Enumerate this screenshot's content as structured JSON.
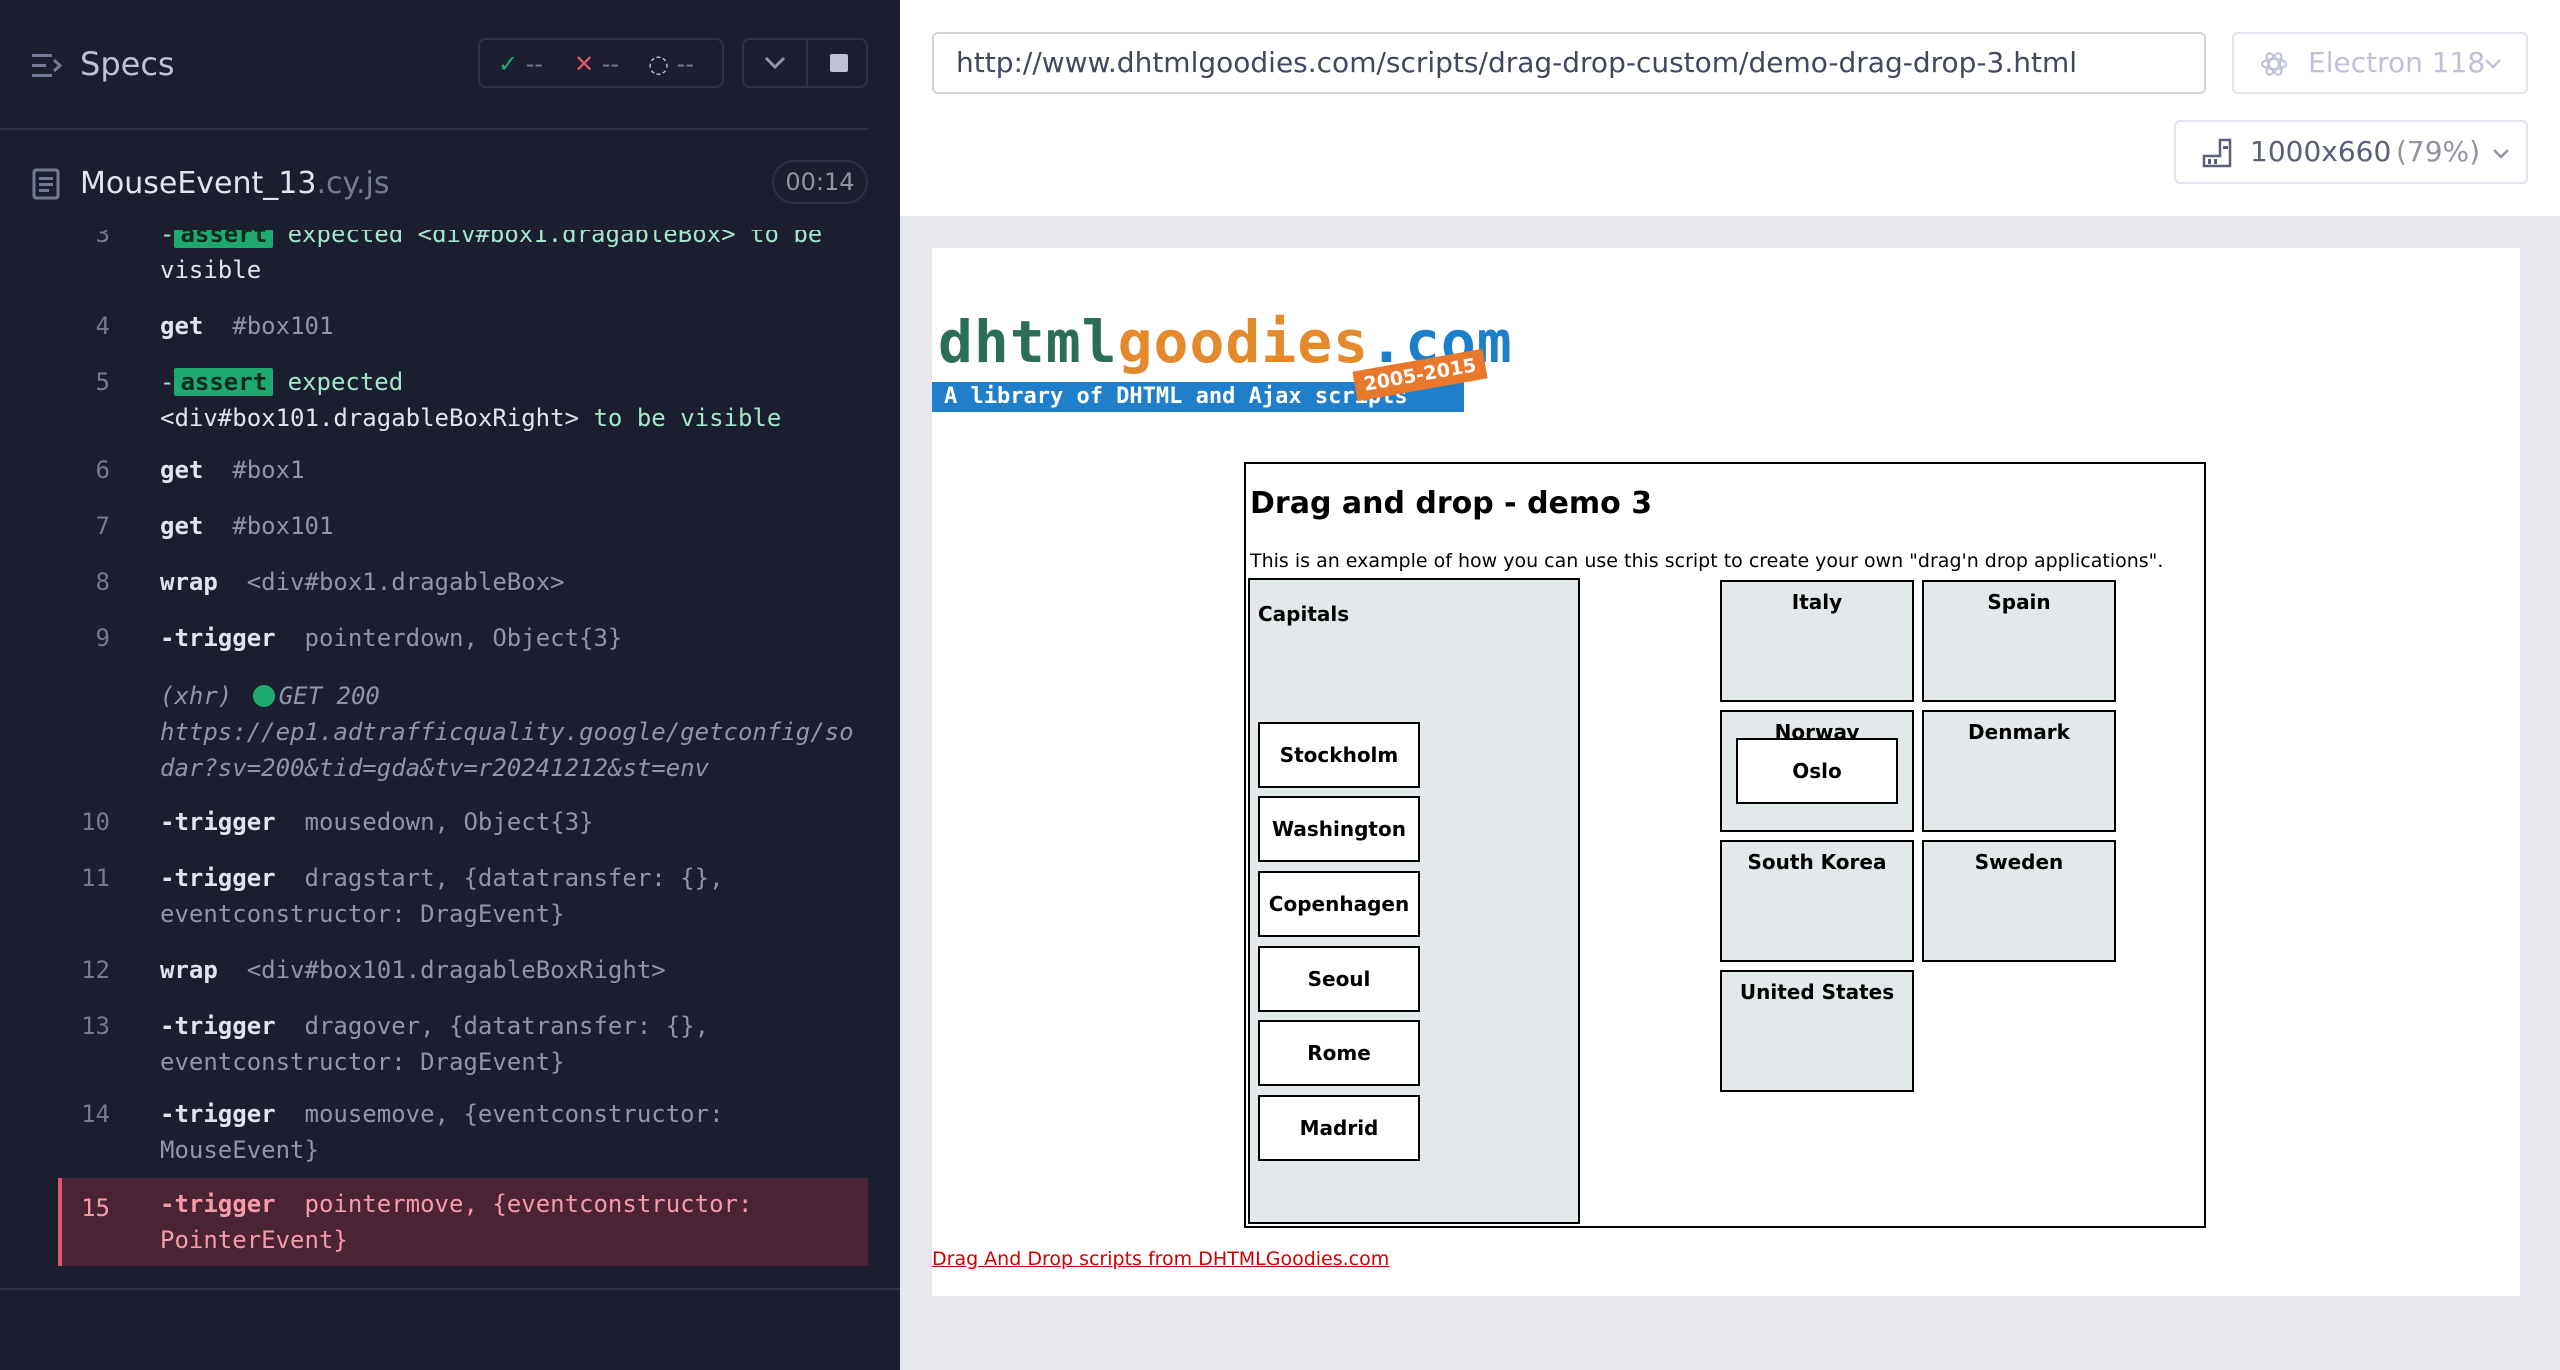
{
  "runner": {
    "specs_title": "Specs",
    "stats": {
      "passed": "--",
      "failed": "--",
      "pending": "--"
    },
    "spec_file": {
      "name": "MouseEvent_13",
      "ext": ".cy.js"
    },
    "timer": "00:14",
    "commands": [
      {
        "num": "3",
        "kind": "assert",
        "badge": "assert",
        "text1": "expected",
        "text2": "<div#box1.dragableBox>",
        "text3": "to be",
        "text4": "visible"
      },
      {
        "num": "4",
        "kind": "get",
        "name": "get",
        "arg": "#box101"
      },
      {
        "num": "5",
        "kind": "assert",
        "badge": "assert",
        "text1": "expected",
        "text2": "<div#box101.dragableBoxRight>",
        "text3": "to be",
        "text4": "visible"
      },
      {
        "num": "6",
        "kind": "get",
        "name": "get",
        "arg": "#box1"
      },
      {
        "num": "7",
        "kind": "get",
        "name": "get",
        "arg": "#box101"
      },
      {
        "num": "8",
        "kind": "wrap",
        "name": "wrap",
        "arg": "<div#box1.dragableBox>"
      },
      {
        "num": "9",
        "kind": "trigger",
        "name": "-trigger",
        "arg": "pointerdown, Object{3}"
      },
      {
        "num": "",
        "kind": "xhr",
        "label": "(xhr)",
        "status": "GET 200",
        "url1": "https://ep1.adtrafficquality.google/getconfig/so",
        "url2": "dar?sv=200&tid=gda&tv=r20241212&st=env"
      },
      {
        "num": "10",
        "kind": "trigger",
        "name": "-trigger",
        "arg": "mousedown, Object{3}"
      },
      {
        "num": "11",
        "kind": "trigger",
        "name": "-trigger",
        "arg": "dragstart, {datatransfer: {},",
        "arg2": "eventconstructor: DragEvent}"
      },
      {
        "num": "12",
        "kind": "wrap",
        "name": "wrap",
        "arg": "<div#box101.dragableBoxRight>"
      },
      {
        "num": "13",
        "kind": "trigger",
        "name": "-trigger",
        "arg": "dragover, {datatransfer: {},",
        "arg2": "eventconstructor: DragEvent}"
      },
      {
        "num": "14",
        "kind": "trigger",
        "name": "-trigger",
        "arg": "mousemove, {eventconstructor:",
        "arg2": "MouseEvent}"
      },
      {
        "num": "15",
        "kind": "trigger",
        "name": "-trigger",
        "arg": "pointermove, {eventconstructor:",
        "arg2": "PointerEvent}"
      }
    ]
  },
  "browser": {
    "url": "http://www.dhtmlgoodies.com/scripts/drag-drop-custom/demo-drag-drop-3.html",
    "browser_label": "Electron 118",
    "viewport_size": "1000x660",
    "viewport_scale": "(79%)"
  },
  "site": {
    "logo": {
      "part1": "dhtml",
      "part2": "goodies",
      "part3": ".com",
      "tagline": "A library of DHTML and Ajax scripts",
      "years": "2005-2015"
    },
    "title": "Drag and drop - demo 3",
    "description": "This is an example of how you can use this script to create your own \"drag'n drop applications\".",
    "capitals_label": "Capitals",
    "capitals": [
      "Stockholm",
      "Washington",
      "Copenhagen",
      "Seoul",
      "Rome",
      "Madrid"
    ],
    "countries": [
      "Italy",
      "Spain",
      "Norway",
      "Denmark",
      "South Korea",
      "Sweden",
      "United States"
    ],
    "dropped_capital": "Oslo",
    "footer_link": "Drag And Drop scripts from DHTMLGoodies.com"
  },
  "colors": {
    "runner_bg": "#1b1e2e",
    "pass": "#1fa971",
    "fail": "#e45770",
    "link": "#d00000"
  }
}
